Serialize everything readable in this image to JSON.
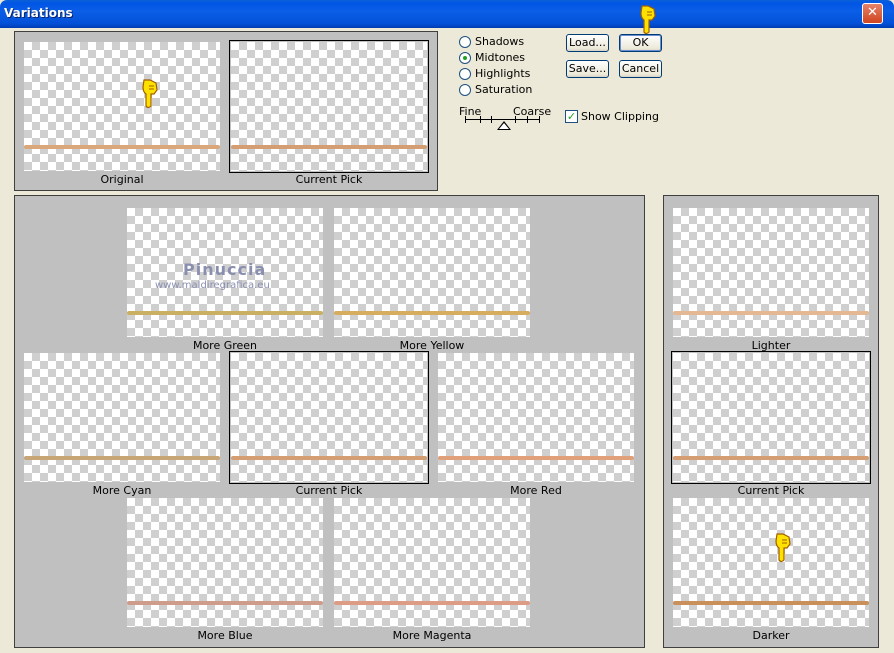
{
  "window": {
    "title": "Variations",
    "close_glyph": "✕"
  },
  "options": {
    "radios": [
      {
        "label": "Shadows",
        "checked": false
      },
      {
        "label": "Midtones",
        "checked": true
      },
      {
        "label": "Highlights",
        "checked": false
      },
      {
        "label": "Saturation",
        "checked": false
      }
    ],
    "slider": {
      "left_label": "Fine",
      "right_label": "Coarse"
    },
    "show_clipping": {
      "label": "Show Clipping",
      "checked": true,
      "mark": "✓"
    }
  },
  "buttons": {
    "load": "Load...",
    "ok": "OK",
    "save": "Save...",
    "cancel": "Cancel"
  },
  "top_panel": {
    "original": "Original",
    "current_pick": "Current Pick"
  },
  "grid": {
    "more_green": "More Green",
    "more_yellow": "More Yellow",
    "more_cyan": "More Cyan",
    "current_pick": "Current Pick",
    "more_red": "More Red",
    "more_blue": "More Blue",
    "more_magenta": "More Magenta"
  },
  "watermark": {
    "line1": "Pinuccia",
    "line2": "www.maldiregrafica.eu"
  },
  "lightness": {
    "lighter": "Lighter",
    "current_pick": "Current Pick",
    "darker": "Darker"
  },
  "colors": {
    "strip_original": "#d9a77a",
    "strip_green": "#c9b063",
    "strip_yellow": "#d6ad5e",
    "strip_cyan": "#c8a574",
    "strip_red": "#e0a07a",
    "strip_blue": "#cf9c8c",
    "strip_magenta": "#dd9c86",
    "strip_lighter": "#e3b892",
    "strip_darker": "#c9905c"
  },
  "icons": {
    "hand": "pointing-hand-icon"
  }
}
